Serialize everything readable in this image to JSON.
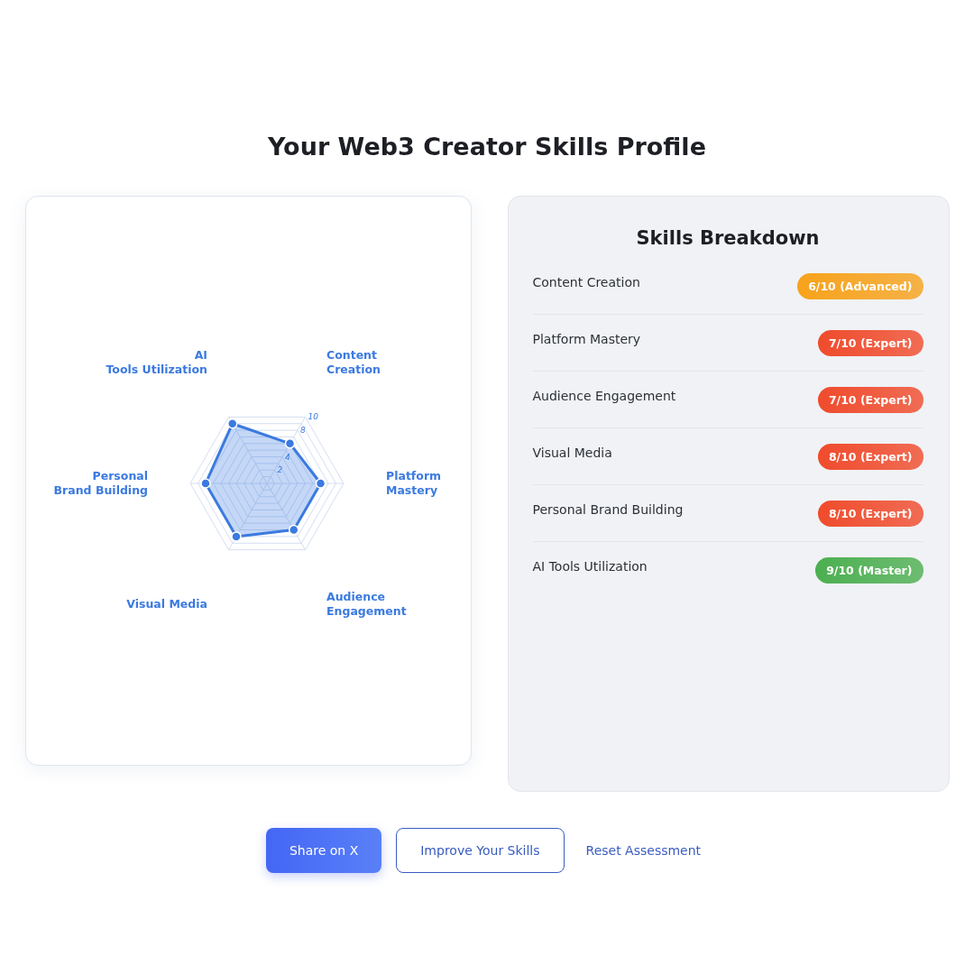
{
  "title": "Your Web3 Creator Skills Profile",
  "radar": {
    "axes": [
      {
        "label": "AI\nTools Utilization"
      },
      {
        "label": "Content\nCreation"
      },
      {
        "label": "Personal\nBrand Building"
      },
      {
        "label": "Platform\nMastery"
      },
      {
        "label": "Visual Media"
      },
      {
        "label": "Audience\nEngagement"
      }
    ],
    "tick_labels": [
      "10",
      "8",
      "4",
      "2"
    ]
  },
  "breakdown": {
    "title": "Skills Breakdown",
    "skills": [
      {
        "name": "Content Creation",
        "score": "6/10 (Advanced)",
        "color": "#f7a21b"
      },
      {
        "name": "Platform Mastery",
        "score": "7/10 (Expert)",
        "color": "#f04b2c"
      },
      {
        "name": "Audience Engagement",
        "score": "7/10 (Expert)",
        "color": "#f04b2c"
      },
      {
        "name": "Visual Media",
        "score": "8/10 (Expert)",
        "color": "#f04b2c"
      },
      {
        "name": "Personal Brand Building",
        "score": "8/10 (Expert)",
        "color": "#f04b2c"
      },
      {
        "name": "AI Tools Utilization",
        "score": "9/10 (Master)",
        "color": "#4caf50"
      }
    ]
  },
  "actions": [
    {
      "label": "Share on X",
      "kind": "primary"
    },
    {
      "label": "Improve Your Skills",
      "kind": "outline"
    },
    {
      "label": "Reset Assessment",
      "kind": "link"
    }
  ]
}
